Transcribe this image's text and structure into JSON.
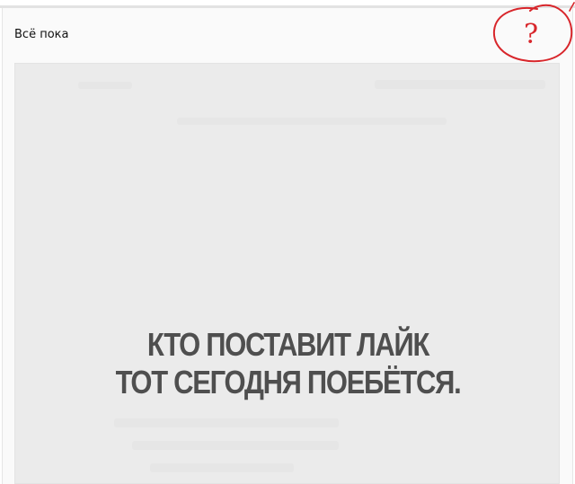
{
  "post": {
    "title": "Всё пока",
    "annotation_mark": "?",
    "image_caption": {
      "line1": "КТО ПОСТАВИТ ЛАЙК",
      "line2": "ТОТ СЕГОДНЯ ПОЕБЁТСЯ."
    }
  },
  "colors": {
    "annotation": "#d8262b",
    "caption_text": "#4f4f4f",
    "image_background": "#ebebeb"
  },
  "icons": {
    "annotation": "red-circle-question-mark-icon"
  }
}
